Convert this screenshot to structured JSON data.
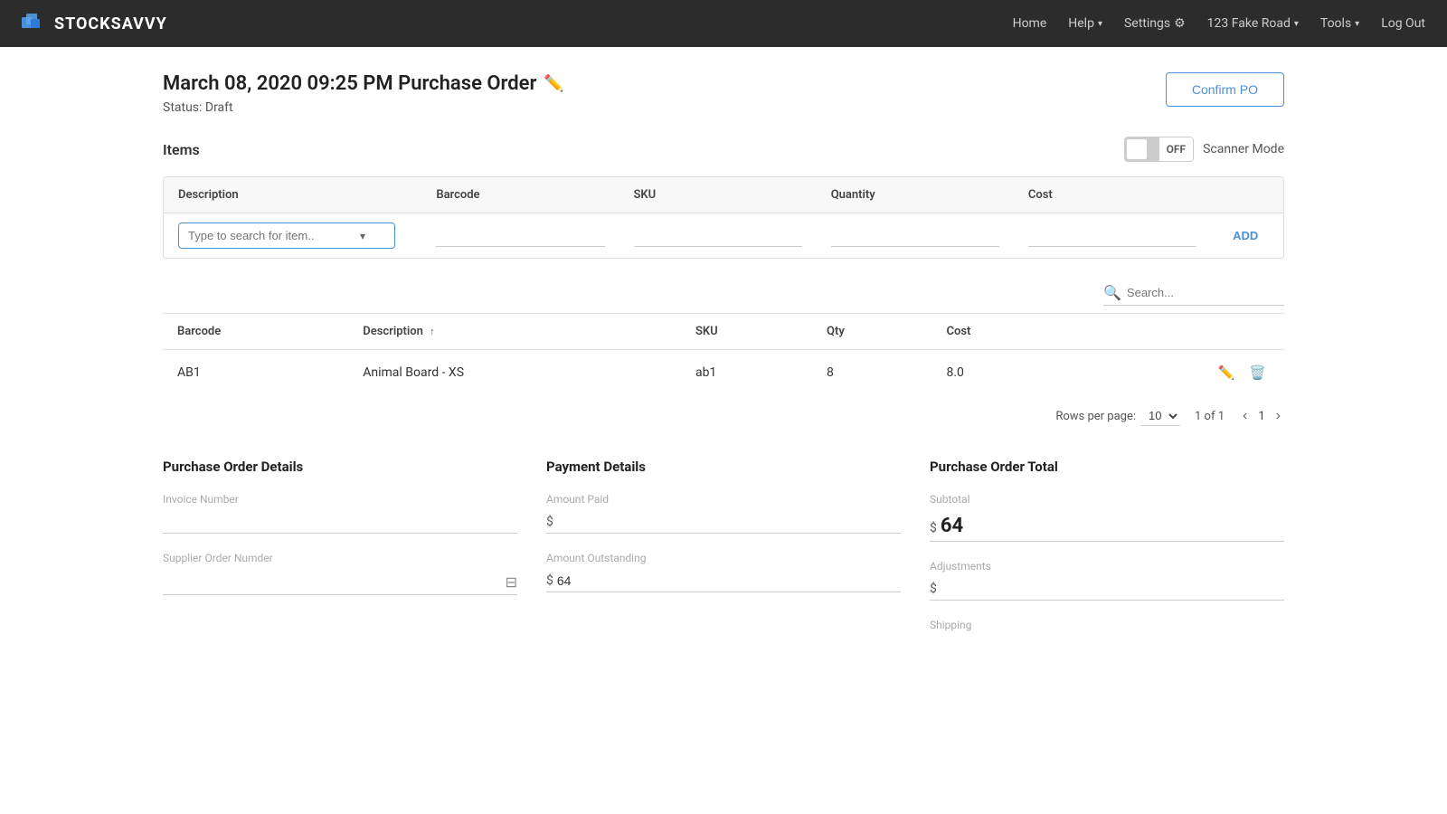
{
  "brand": {
    "name": "STOCKSAVVY"
  },
  "nav": {
    "items": [
      {
        "label": "Home",
        "hasDropdown": false
      },
      {
        "label": "Help",
        "hasDropdown": true
      },
      {
        "label": "Settings",
        "hasDropdown": false,
        "hasIcon": true
      },
      {
        "label": "123 Fake Road",
        "hasDropdown": true
      },
      {
        "label": "Tools",
        "hasDropdown": true
      },
      {
        "label": "Log Out",
        "hasDropdown": false
      }
    ]
  },
  "page": {
    "title": "March 08, 2020 09:25 PM Purchase Order",
    "status": "Status: Draft",
    "confirm_button": "Confirm PO"
  },
  "items_section": {
    "title": "Items",
    "scanner_mode_label": "Scanner Mode",
    "toggle_label": "OFF"
  },
  "add_row": {
    "description_placeholder": "Type to search for item..",
    "add_button": "ADD"
  },
  "search": {
    "placeholder": "Search..."
  },
  "table_headers": {
    "barcode": "Barcode",
    "description": "Description",
    "sku": "SKU",
    "qty": "Qty",
    "cost": "Cost",
    "quantity": "Quantity"
  },
  "table_rows": [
    {
      "barcode": "AB1",
      "description": "Animal Board - XS",
      "sku": "ab1",
      "qty": "8",
      "cost": "8.0"
    }
  ],
  "pagination": {
    "rows_per_page_label": "Rows per page:",
    "rows_per_page_value": "10",
    "page_info": "1 of 1",
    "current_page": "1"
  },
  "purchase_order_details": {
    "title": "Purchase Order Details",
    "invoice_number_label": "Invoice Number",
    "invoice_number_value": "",
    "supplier_order_label": "Supplier Order Numder",
    "supplier_order_value": ""
  },
  "payment_details": {
    "title": "Payment Details",
    "amount_paid_label": "Amount Paid",
    "amount_paid_value": "",
    "amount_outstanding_label": "Amount Outstanding",
    "amount_outstanding_value": "64"
  },
  "order_total": {
    "title": "Purchase Order Total",
    "subtotal_label": "Subtotal",
    "subtotal_value": "64",
    "adjustments_label": "Adjustments",
    "adjustments_value": "",
    "shipping_label": "Shipping"
  }
}
